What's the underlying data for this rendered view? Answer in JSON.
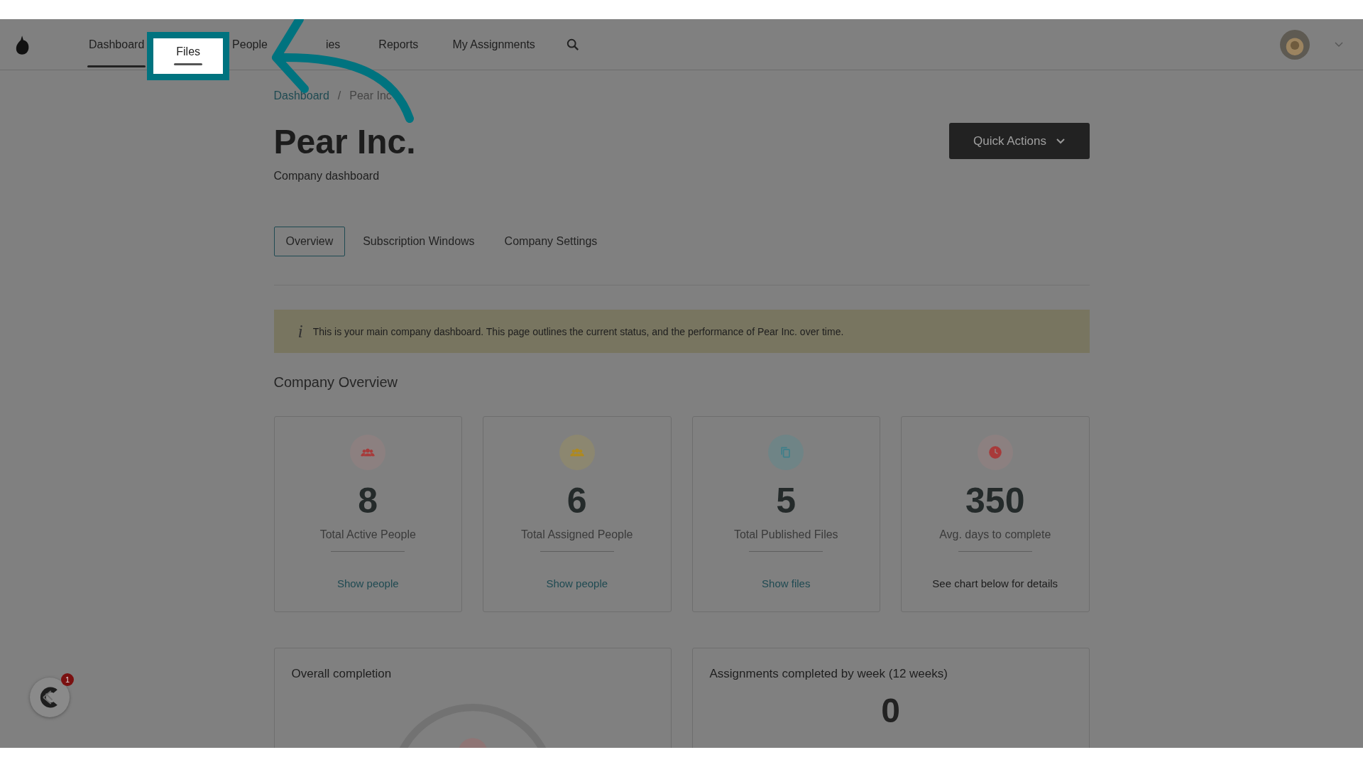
{
  "nav": {
    "items": [
      {
        "label": "Dashboard",
        "selected": true,
        "highlighted": false
      },
      {
        "label": "Files",
        "selected": false,
        "highlighted": true
      },
      {
        "label": "People",
        "selected": false,
        "highlighted": false
      },
      {
        "label": "ies",
        "selected": false,
        "highlighted": false
      },
      {
        "label": "Reports",
        "selected": false,
        "highlighted": false
      },
      {
        "label": "My Assignments",
        "selected": false,
        "highlighted": false
      }
    ]
  },
  "breadcrumb": [
    {
      "kind": "link",
      "text": "Dashboard"
    },
    {
      "kind": "separator",
      "text": "/"
    },
    {
      "kind": "current",
      "text": "Pear Inc"
    }
  ],
  "page": {
    "title": "Pear Inc.",
    "subtitle": "Company dashboard",
    "action_button": "Quick Actions"
  },
  "tabs": [
    {
      "label": "Overview",
      "selected": true
    },
    {
      "label": "Subscription Windows",
      "selected": false
    },
    {
      "label": "Company Settings",
      "selected": false
    }
  ],
  "info_banner": {
    "icon": "i",
    "text": "This is your main company dashboard. This page outlines the current status, and the performance of Pear Inc. over time."
  },
  "section_title": "Company Overview",
  "stats": [
    {
      "kind": "link",
      "color": "#a83a3a",
      "value": "8",
      "label": "Total Active People",
      "link": "Show people"
    },
    {
      "kind": "link",
      "color": "#b08a1e",
      "value": "6",
      "label": "Total Assigned People",
      "link": "Show people"
    },
    {
      "kind": "link",
      "color": "#3f7f8a",
      "value": "5",
      "label": "Total Published Files",
      "link": "Show files"
    },
    {
      "kind": "note",
      "color": "#a83a3a",
      "value": "350",
      "label": "Avg. days to complete",
      "link": "See chart below for details"
    }
  ],
  "panels": [
    {
      "title": "Overall completion",
      "kind": "gauge"
    },
    {
      "title": "Assignments completed by week (12 weeks)",
      "kind": "number",
      "value": "0"
    }
  ],
  "chat_widget": {
    "badge": "1"
  }
}
